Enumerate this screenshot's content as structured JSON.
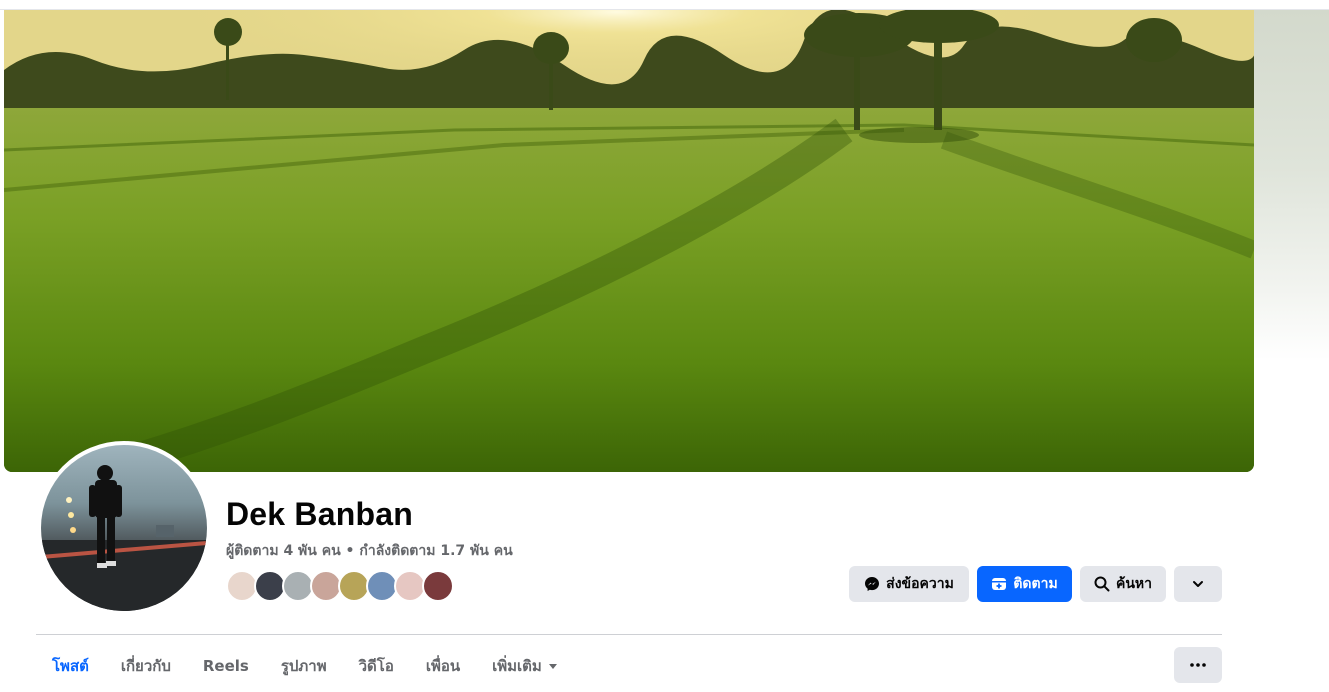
{
  "profile": {
    "name": "Dek Banban",
    "stats": "ผู้ติดตาม 4 พัน คน • กำลังติดตาม 1.7 พัน คน"
  },
  "friends_preview": [
    {
      "color": "#e8d6cc"
    },
    {
      "color": "#3b3f4a"
    },
    {
      "color": "#a9b0b3"
    },
    {
      "color": "#c9a59a"
    },
    {
      "color": "#b7a458"
    },
    {
      "color": "#6f8fb8"
    },
    {
      "color": "#e6c7c2"
    },
    {
      "color": "#7a3a3c"
    }
  ],
  "actions": {
    "message_label": "ส่งข้อความ",
    "follow_label": "ติดตาม",
    "search_label": "ค้นหา"
  },
  "tabs": [
    {
      "label": "โพสต์",
      "active": true
    },
    {
      "label": "เกี่ยวกับ"
    },
    {
      "label": "Reels"
    },
    {
      "label": "รูปภาพ"
    },
    {
      "label": "วิดีโอ"
    },
    {
      "label": "เพื่อน"
    },
    {
      "label": "เพิ่มเติม",
      "dropdown": true
    }
  ],
  "colors": {
    "accent": "#0866ff",
    "button_gray": "#e4e6eb",
    "secondary_text": "#65676b"
  },
  "icons": [
    "messenger-icon",
    "follow-icon",
    "search-icon",
    "chevron-down-icon",
    "caret-down-icon",
    "more-dots-icon"
  ]
}
